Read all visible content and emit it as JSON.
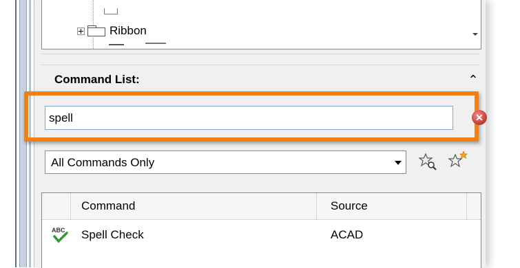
{
  "tree": {
    "visible_item": "Ribbon"
  },
  "command_list": {
    "title": "Command List:",
    "search_value": "spell",
    "filter": {
      "selected": "All Commands Only"
    },
    "columns": [
      "Command",
      "Source"
    ],
    "rows": [
      {
        "icon": "spell-check-icon",
        "command": "Spell Check",
        "source": "ACAD"
      }
    ]
  },
  "colors": {
    "highlight": "#f27f13",
    "clear_button": "#c0392b",
    "spell_check_mark": "#2e9a2e"
  }
}
